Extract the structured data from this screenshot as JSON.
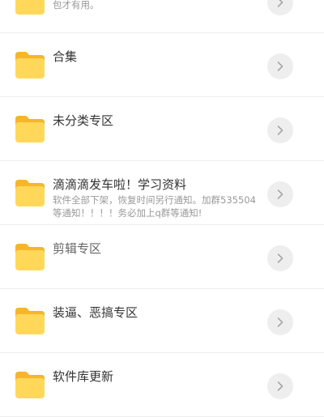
{
  "colors": {
    "folder_front": "#FFD85A",
    "folder_back": "#F7B52C",
    "arrow_bg": "#EEEEEE",
    "arrow_stroke": "#9E9E9E",
    "divider": "#EEEEEE"
  },
  "icons": {
    "folder": "folder-icon",
    "arrow": "chevron-right-icon"
  },
  "folders": [
    {
      "title": "",
      "desc": "使用说明:必须要把原版QQ卸载，然后在安装美化包才有用。"
    },
    {
      "title": "合集",
      "desc": ""
    },
    {
      "title": "未分类专区",
      "desc": ""
    },
    {
      "title": "滴滴滴发车啦！学习资料",
      "desc": "软件全部下架，恢复时间另行通知。加群535504等通知！！！！务必加上q群等通知!"
    },
    {
      "title": "剪辑专区",
      "desc": ""
    },
    {
      "title": "装逼、恶搞专区",
      "desc": ""
    },
    {
      "title": "软件库更新",
      "desc": ""
    }
  ]
}
